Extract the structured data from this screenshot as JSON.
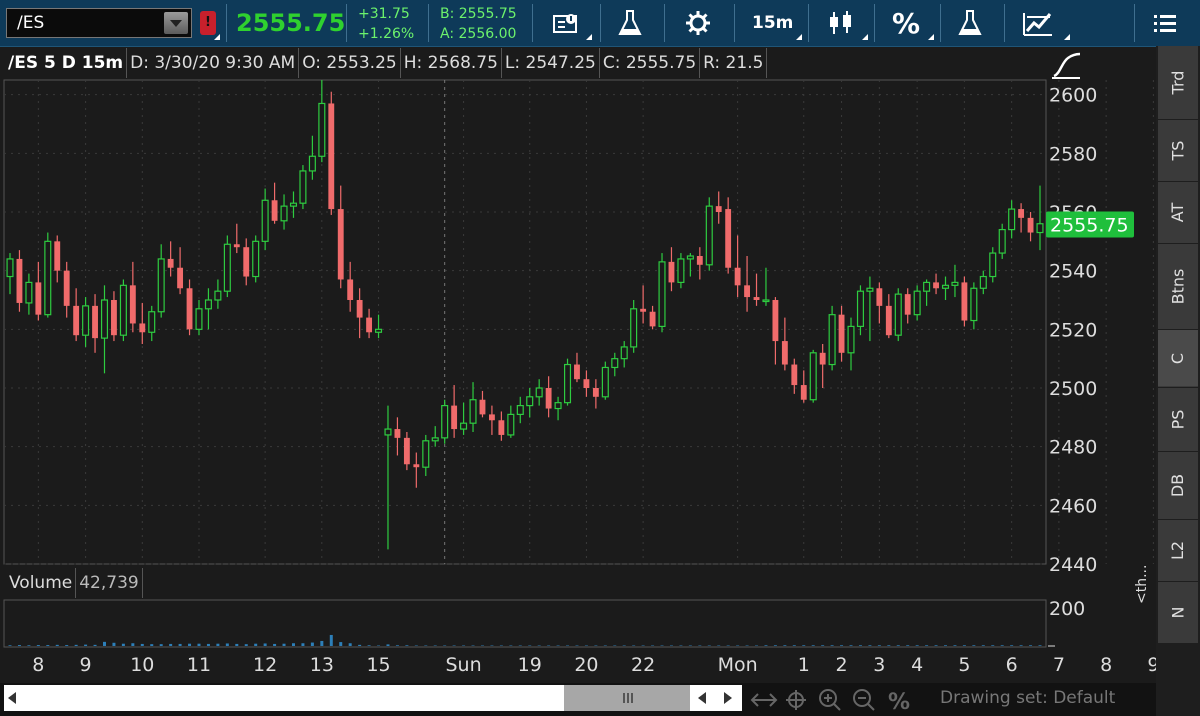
{
  "toolbar": {
    "symbol": "/ES",
    "last_price": "2555.75",
    "change_abs": "+31.75",
    "change_pct": "+1.26%",
    "bid": "B: 2555.75",
    "ask": "A: 2556.00",
    "timeframe": "15m",
    "percent_label": "%"
  },
  "chart_header": {
    "title": "/ES 5 D 15m",
    "date": "D: 3/30/20 9:30 AM",
    "open": "O: 2553.25",
    "high": "H: 2568.75",
    "low": "L: 2547.25",
    "close": "C: 2555.75",
    "range": "R: 21.5"
  },
  "volume_panel": {
    "label": "Volume",
    "value": "42,739",
    "ticks": [
      "200"
    ],
    "color": "#2d7fb8"
  },
  "right_tabs": [
    "Trd",
    "TS",
    "AT",
    "Btns",
    "C",
    "PS",
    "DB",
    "L2",
    "N"
  ],
  "active_tab": "C",
  "collapsed_hint": "<th...",
  "drawing_set": "Drawing set: Default",
  "colors": {
    "up": "#2ecc40",
    "down": "#f06b6b",
    "price_tag": "#1fbf3c",
    "toolbar_bg": "#0e3a59"
  },
  "chart_data": {
    "type": "candlestick",
    "symbol": "/ES",
    "interval": "15m",
    "y_range": [
      2440,
      2605
    ],
    "y_ticks": [
      2440,
      2460,
      2480,
      2500,
      2520,
      2540,
      2560,
      2580,
      2600
    ],
    "x_labels": [
      {
        "label": "8",
        "idx": 3
      },
      {
        "label": "9",
        "idx": 8
      },
      {
        "label": "10",
        "idx": 14
      },
      {
        "label": "11",
        "idx": 20
      },
      {
        "label": "12",
        "idx": 27
      },
      {
        "label": "13",
        "idx": 33
      },
      {
        "label": "15",
        "idx": 39
      },
      {
        "label": "Sun",
        "idx": 48
      },
      {
        "label": "19",
        "idx": 55
      },
      {
        "label": "20",
        "idx": 61
      },
      {
        "label": "22",
        "idx": 67
      },
      {
        "label": "Mon",
        "idx": 77
      },
      {
        "label": "1",
        "idx": 84
      },
      {
        "label": "2",
        "idx": 88
      },
      {
        "label": "3",
        "idx": 92
      },
      {
        "label": "4",
        "idx": 96
      },
      {
        "label": "5",
        "idx": 101
      },
      {
        "label": "6",
        "idx": 106
      },
      {
        "label": "7",
        "idx": 111
      },
      {
        "label": "8",
        "idx": 116
      },
      {
        "label": "9",
        "idx": 121
      }
    ],
    "session_break_idx": 46,
    "last_price": 2555.75,
    "candles": [
      [
        2538,
        2546,
        2532,
        2544
      ],
      [
        2544,
        2547,
        2526,
        2529
      ],
      [
        2529,
        2539,
        2525,
        2536
      ],
      [
        2536,
        2543,
        2523,
        2525
      ],
      [
        2525,
        2553,
        2524,
        2550
      ],
      [
        2550,
        2552,
        2536,
        2540
      ],
      [
        2540,
        2543,
        2524,
        2528
      ],
      [
        2528,
        2534,
        2516,
        2518
      ],
      [
        2518,
        2531,
        2514,
        2528
      ],
      [
        2528,
        2532,
        2512,
        2517
      ],
      [
        2517,
        2535,
        2505,
        2530
      ],
      [
        2530,
        2533,
        2516,
        2518
      ],
      [
        2518,
        2537,
        2516,
        2535
      ],
      [
        2535,
        2543,
        2519,
        2522
      ],
      [
        2522,
        2529,
        2515,
        2519
      ],
      [
        2519,
        2528,
        2516,
        2526
      ],
      [
        2526,
        2549,
        2524,
        2544
      ],
      [
        2544,
        2550,
        2538,
        2541
      ],
      [
        2541,
        2548,
        2532,
        2534
      ],
      [
        2534,
        2537,
        2518,
        2520
      ],
      [
        2520,
        2530,
        2518,
        2527
      ],
      [
        2527,
        2534,
        2520,
        2530
      ],
      [
        2530,
        2537,
        2527,
        2533
      ],
      [
        2533,
        2552,
        2531,
        2549
      ],
      [
        2549,
        2556,
        2546,
        2548
      ],
      [
        2548,
        2551,
        2535,
        2538
      ],
      [
        2538,
        2552,
        2536,
        2550
      ],
      [
        2550,
        2568,
        2547,
        2564
      ],
      [
        2564,
        2570,
        2556,
        2557
      ],
      [
        2557,
        2566,
        2554,
        2562
      ],
      [
        2562,
        2567,
        2558,
        2563
      ],
      [
        2563,
        2576,
        2561,
        2574
      ],
      [
        2574,
        2586,
        2571,
        2579
      ],
      [
        2579,
        2605,
        2577,
        2597
      ],
      [
        2597,
        2601,
        2559,
        2561
      ],
      [
        2561,
        2569,
        2534,
        2537
      ],
      [
        2537,
        2543,
        2526,
        2530
      ],
      [
        2530,
        2534,
        2517,
        2524
      ],
      [
        2524,
        2527,
        2517,
        2519
      ],
      [
        2519,
        2525,
        2517,
        2520
      ],
      [
        2484,
        2494,
        2445,
        2486
      ],
      [
        2486,
        2490,
        2477,
        2483
      ],
      [
        2483,
        2485,
        2472,
        2474
      ],
      [
        2474,
        2478,
        2466,
        2473
      ],
      [
        2473,
        2484,
        2470,
        2482
      ],
      [
        2482,
        2487,
        2480,
        2483
      ],
      [
        2483,
        2496,
        2481,
        2494
      ],
      [
        2494,
        2501,
        2483,
        2486
      ],
      [
        2486,
        2495,
        2484,
        2488
      ],
      [
        2488,
        2502,
        2485,
        2496
      ],
      [
        2496,
        2499,
        2490,
        2491
      ],
      [
        2491,
        2494,
        2484,
        2489
      ],
      [
        2489,
        2492,
        2482,
        2484
      ],
      [
        2484,
        2494,
        2483,
        2491
      ],
      [
        2491,
        2497,
        2488,
        2494
      ],
      [
        2494,
        2500,
        2490,
        2497
      ],
      [
        2497,
        2503,
        2494,
        2500
      ],
      [
        2500,
        2504,
        2490,
        2493
      ],
      [
        2493,
        2497,
        2489,
        2495
      ],
      [
        2495,
        2510,
        2494,
        2508
      ],
      [
        2508,
        2512,
        2502,
        2503
      ],
      [
        2503,
        2506,
        2497,
        2500
      ],
      [
        2500,
        2503,
        2493,
        2497
      ],
      [
        2497,
        2509,
        2496,
        2507
      ],
      [
        2507,
        2512,
        2504,
        2510
      ],
      [
        2510,
        2516,
        2507,
        2514
      ],
      [
        2514,
        2530,
        2512,
        2527
      ],
      [
        2527,
        2535,
        2522,
        2526
      ],
      [
        2526,
        2528,
        2520,
        2521
      ],
      [
        2521,
        2546,
        2519,
        2543
      ],
      [
        2543,
        2548,
        2533,
        2536
      ],
      [
        2536,
        2546,
        2534,
        2544
      ],
      [
        2544,
        2546,
        2538,
        2545
      ],
      [
        2545,
        2548,
        2537,
        2542
      ],
      [
        2542,
        2565,
        2540,
        2562
      ],
      [
        2562,
        2567,
        2556,
        2560
      ],
      [
        2561,
        2565,
        2539,
        2541
      ],
      [
        2541,
        2552,
        2531,
        2535
      ],
      [
        2535,
        2545,
        2526,
        2531
      ],
      [
        2531,
        2539,
        2528,
        2530
      ],
      [
        2530,
        2541,
        2528,
        2530
      ],
      [
        2530,
        2531,
        2508,
        2516
      ],
      [
        2516,
        2524,
        2506,
        2508
      ],
      [
        2508,
        2510,
        2498,
        2501
      ],
      [
        2501,
        2506,
        2495,
        2496
      ],
      [
        2496,
        2513,
        2495,
        2512
      ],
      [
        2512,
        2515,
        2500,
        2508
      ],
      [
        2508,
        2528,
        2506,
        2525
      ],
      [
        2525,
        2528,
        2509,
        2512
      ],
      [
        2512,
        2524,
        2506,
        2521
      ],
      [
        2521,
        2535,
        2518,
        2533
      ],
      [
        2533,
        2538,
        2516,
        2534
      ],
      [
        2534,
        2536,
        2522,
        2528
      ],
      [
        2528,
        2532,
        2517,
        2518
      ],
      [
        2518,
        2534,
        2516,
        2532
      ],
      [
        2532,
        2534,
        2522,
        2525
      ],
      [
        2525,
        2535,
        2523,
        2533
      ],
      [
        2533,
        2537,
        2528,
        2536
      ],
      [
        2536,
        2539,
        2532,
        2534
      ],
      [
        2534,
        2538,
        2530,
        2535
      ],
      [
        2535,
        2542,
        2531,
        2536
      ],
      [
        2536,
        2538,
        2521,
        2523
      ],
      [
        2523,
        2536,
        2520,
        2534
      ],
      [
        2534,
        2540,
        2532,
        2538
      ],
      [
        2538,
        2548,
        2536,
        2546
      ],
      [
        2546,
        2556,
        2544,
        2554
      ],
      [
        2554,
        2564,
        2551,
        2561
      ],
      [
        2561,
        2563,
        2553,
        2558
      ],
      [
        2558,
        2560,
        2550,
        2553
      ],
      [
        2553,
        2569,
        2547,
        2556
      ]
    ],
    "volume": [
      3,
      4,
      3,
      4,
      4,
      5,
      4,
      5,
      6,
      5,
      18,
      14,
      10,
      12,
      9,
      8,
      8,
      9,
      9,
      10,
      10,
      9,
      10,
      11,
      9,
      8,
      10,
      11,
      9,
      10,
      12,
      12,
      15,
      22,
      48,
      17,
      12,
      5,
      3,
      2,
      7,
      3,
      3,
      2,
      2,
      2,
      2,
      2,
      2,
      2,
      2,
      2,
      2,
      2,
      2,
      2,
      2,
      2,
      2,
      2,
      2,
      2,
      2,
      2,
      2,
      2,
      2,
      2,
      2,
      2,
      2,
      2,
      2,
      2,
      2,
      2,
      2,
      2,
      2,
      2,
      3,
      3,
      3,
      3,
      3,
      3,
      3,
      3,
      3,
      3,
      3,
      3,
      3,
      3,
      3,
      3,
      3,
      3,
      3,
      3,
      3,
      3,
      3,
      3,
      3,
      3,
      3,
      3,
      3,
      3,
      3,
      3,
      3,
      3,
      3,
      3,
      3,
      3,
      3,
      3,
      3,
      3,
      3,
      3,
      3,
      3,
      4,
      4,
      5,
      6,
      11,
      12
    ],
    "volume_range": [
      0,
      200
    ]
  }
}
